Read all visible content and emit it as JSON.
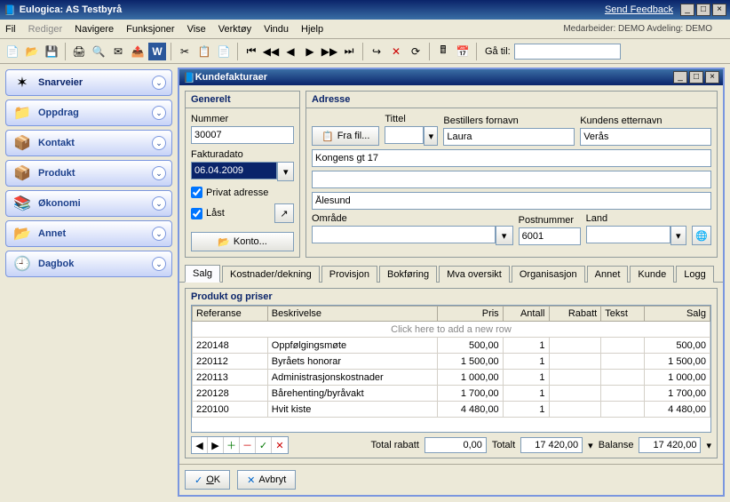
{
  "app": {
    "title": "Eulogica: AS Testbyrå",
    "feedback": "Send Feedback"
  },
  "menu": {
    "fil": "Fil",
    "rediger": "Rediger",
    "navigere": "Navigere",
    "funksjoner": "Funksjoner",
    "vise": "Vise",
    "verktoy": "Verktøy",
    "vindu": "Vindu",
    "hjelp": "Hjelp",
    "info": "Medarbeider: DEMO   Avdeling: DEMO"
  },
  "toolbar": {
    "goto_label": "Gå til:",
    "goto_value": ""
  },
  "sidebar": {
    "items": [
      {
        "label": "Snarveier",
        "icon": "✶"
      },
      {
        "label": "Oppdrag",
        "icon": "📁"
      },
      {
        "label": "Kontakt",
        "icon": "📦"
      },
      {
        "label": "Produkt",
        "icon": "📦"
      },
      {
        "label": "Økonomi",
        "icon": "📚"
      },
      {
        "label": "Annet",
        "icon": "📂"
      },
      {
        "label": "Dagbok",
        "icon": "🕘"
      }
    ]
  },
  "inner": {
    "title": "Kundefakturaer"
  },
  "general": {
    "heading": "Generelt",
    "nummer_label": "Nummer",
    "nummer": "30007",
    "dato_label": "Fakturadato",
    "dato": "06.04.2009",
    "privat": "Privat adresse",
    "last": "Låst",
    "konto_btn": "Konto..."
  },
  "address": {
    "heading": "Adresse",
    "frafil": "Fra fil...",
    "tittel_label": "Tittel",
    "tittel": "",
    "fornavn_label": "Bestillers fornavn",
    "fornavn": "Laura",
    "etternavn_label": "Kundens etternavn",
    "etternavn": "Verås",
    "line1": "Kongens gt 17",
    "line2": "",
    "by": "Ålesund",
    "omrade_label": "Område",
    "omrade": "",
    "postnr_label": "Postnummer",
    "postnr": "6001",
    "land_label": "Land",
    "land": ""
  },
  "tabs": [
    "Salg",
    "Kostnader/dekning",
    "Provisjon",
    "Bokføring",
    "Mva oversikt",
    "Organisasjon",
    "Annet",
    "Kunde",
    "Logg"
  ],
  "grid": {
    "heading": "Produkt og priser",
    "cols": {
      "ref": "Referanse",
      "besk": "Beskrivelse",
      "pris": "Pris",
      "antall": "Antall",
      "rabatt": "Rabatt",
      "tekst": "Tekst",
      "salg": "Salg"
    },
    "addrow": "Click here to add a new row",
    "rows": [
      {
        "ref": "220148",
        "besk": "Oppfølgingsmøte",
        "pris": "500,00",
        "antall": "1",
        "rabatt": "",
        "tekst": "",
        "salg": "500,00"
      },
      {
        "ref": "220112",
        "besk": "Byråets honorar",
        "pris": "1 500,00",
        "antall": "1",
        "rabatt": "",
        "tekst": "",
        "salg": "1 500,00"
      },
      {
        "ref": "220113",
        "besk": "Administrasjonskostnader",
        "pris": "1 000,00",
        "antall": "1",
        "rabatt": "",
        "tekst": "",
        "salg": "1 000,00"
      },
      {
        "ref": "220128",
        "besk": "Bårehenting/byråvakt",
        "pris": "1 700,00",
        "antall": "1",
        "rabatt": "",
        "tekst": "",
        "salg": "1 700,00"
      },
      {
        "ref": "220100",
        "besk": "Hvit kiste",
        "pris": "4 480,00",
        "antall": "1",
        "rabatt": "",
        "tekst": "",
        "salg": "4 480,00"
      }
    ],
    "totals": {
      "rabatt_label": "Total rabatt",
      "rabatt": "0,00",
      "totalt_label": "Totalt",
      "totalt": "17 420,00",
      "balanse_label": "Balanse",
      "balanse": "17 420,00"
    }
  },
  "dialog": {
    "ok": "OK",
    "avbryt": "Avbryt"
  }
}
